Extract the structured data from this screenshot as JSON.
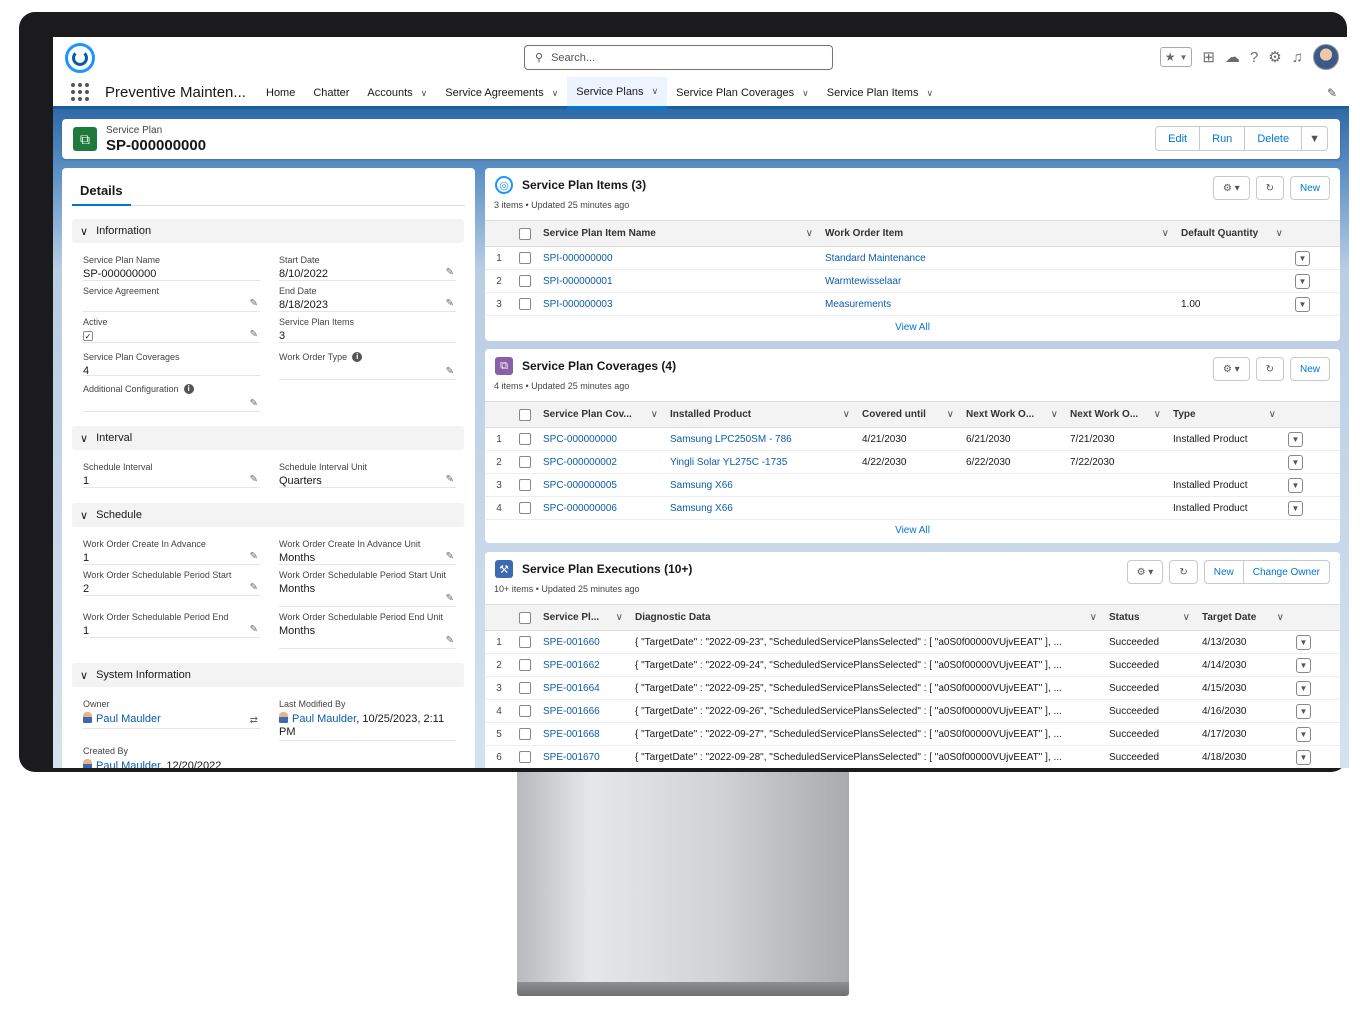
{
  "app": {
    "name": "Preventive Mainten...",
    "search_placeholder": "Search...",
    "nav_tabs": [
      {
        "label": "Home",
        "has_menu": false
      },
      {
        "label": "Chatter",
        "has_menu": false
      },
      {
        "label": "Accounts",
        "has_menu": true
      },
      {
        "label": "Service Agreements",
        "has_menu": true
      },
      {
        "label": "Service Plans",
        "has_menu": true,
        "active": true
      },
      {
        "label": "Service Plan Coverages",
        "has_menu": true
      },
      {
        "label": "Service Plan Items",
        "has_menu": true
      }
    ]
  },
  "record": {
    "type": "Service Plan",
    "name": "SP-000000000",
    "actions": {
      "edit": "Edit",
      "run": "Run",
      "delete": "Delete"
    }
  },
  "details": {
    "tab": "Details",
    "sections": {
      "information": "Information",
      "interval": "Interval",
      "schedule": "Schedule",
      "system": "System Information"
    },
    "fields": {
      "plan_name": {
        "label": "Service Plan Name",
        "value": "SP-000000000"
      },
      "start_date": {
        "label": "Start Date",
        "value": "8/10/2022"
      },
      "agreement": {
        "label": "Service Agreement",
        "value": ""
      },
      "end_date": {
        "label": "End Date",
        "value": "8/18/2023"
      },
      "active": {
        "label": "Active",
        "value": "✓"
      },
      "plan_items": {
        "label": "Service Plan Items",
        "value": "3"
      },
      "coverages": {
        "label": "Service Plan Coverages",
        "value": "4"
      },
      "wo_type": {
        "label": "Work Order Type",
        "value": ""
      },
      "addl_config": {
        "label": "Additional Configuration",
        "value": ""
      },
      "sched_interval": {
        "label": "Schedule Interval",
        "value": "1"
      },
      "sched_interval_unit": {
        "label": "Schedule Interval Unit",
        "value": "Quarters"
      },
      "wo_create_adv": {
        "label": "Work Order Create In Advance",
        "value": "1"
      },
      "wo_create_adv_unit": {
        "label": "Work Order Create In Advance Unit",
        "value": "Months"
      },
      "wo_sched_start": {
        "label": "Work Order Schedulable Period Start",
        "value": "2"
      },
      "wo_sched_start_unit": {
        "label": "Work Order Schedulable Period Start Unit",
        "value": "Months"
      },
      "wo_sched_end": {
        "label": "Work Order Schedulable Period End",
        "value": "1"
      },
      "wo_sched_end_unit": {
        "label": "Work Order Schedulable Period End Unit",
        "value": "Months"
      },
      "owner": {
        "label": "Owner",
        "value": "Paul Maulder"
      },
      "last_modified": {
        "label": "Last Modified By",
        "value": "Paul Maulder",
        "date": ", 10/25/2023, 2:11 PM"
      },
      "created_by": {
        "label": "Created By",
        "value": "Paul Maulder",
        "date": ", 12/20/2022"
      }
    }
  },
  "items_card": {
    "title": "Service Plan Items (3)",
    "subtitle": "3 items • Updated 25 minutes ago",
    "new": "New",
    "view_all": "View All",
    "columns": [
      "Service Plan Item Name",
      "Work Order Item",
      "Default Quantity"
    ],
    "rows": [
      {
        "n": "1",
        "name": "SPI-000000000",
        "item": "Standard Maintenance",
        "qty": ""
      },
      {
        "n": "2",
        "name": "SPI-000000001",
        "item": "Warmtewisselaar",
        "qty": ""
      },
      {
        "n": "3",
        "name": "SPI-000000003",
        "item": "Measurements",
        "qty": "1.00"
      }
    ]
  },
  "coverages_card": {
    "title": "Service Plan Coverages (4)",
    "subtitle": "4 items • Updated 25 minutes ago",
    "new": "New",
    "view_all": "View All",
    "columns": [
      "Service Plan Cov...",
      "Installed Product",
      "Covered until",
      "Next Work O...",
      "Next Work O...",
      "Type"
    ],
    "rows": [
      {
        "n": "1",
        "name": "SPC-000000000",
        "product": "Samsung LPC250SM - 786",
        "covered": "4/21/2030",
        "next1": "6/21/2030",
        "next2": "7/21/2030",
        "type": "Installed Product"
      },
      {
        "n": "2",
        "name": "SPC-000000002",
        "product": "Yingli Solar YL275C -1735",
        "covered": "4/22/2030",
        "next1": "6/22/2030",
        "next2": "7/22/2030",
        "type": ""
      },
      {
        "n": "3",
        "name": "SPC-000000005",
        "product": "Samsung X66",
        "covered": "",
        "next1": "",
        "next2": "",
        "type": "Installed Product"
      },
      {
        "n": "4",
        "name": "SPC-000000006",
        "product": "Samsung X66",
        "covered": "",
        "next1": "",
        "next2": "",
        "type": "Installed Product"
      }
    ]
  },
  "executions_card": {
    "title": "Service Plan Executions (10+)",
    "subtitle": "10+ items • Updated 25 minutes ago",
    "new": "New",
    "change_owner": "Change Owner",
    "columns": [
      "Service Pl...",
      "Diagnostic Data",
      "Status",
      "Target Date"
    ],
    "rows": [
      {
        "n": "1",
        "name": "SPE-001660",
        "diag": "{ \"TargetDate\" : \"2022-09-23\", \"ScheduledServicePlansSelected\" : [ \"a0S0f00000VUjvEEAT\" ], ...",
        "status": "Succeeded",
        "date": "4/13/2030"
      },
      {
        "n": "2",
        "name": "SPE-001662",
        "diag": "{ \"TargetDate\" : \"2022-09-24\", \"ScheduledServicePlansSelected\" : [ \"a0S0f00000VUjvEEAT\" ], ...",
        "status": "Succeeded",
        "date": "4/14/2030"
      },
      {
        "n": "3",
        "name": "SPE-001664",
        "diag": "{ \"TargetDate\" : \"2022-09-25\", \"ScheduledServicePlansSelected\" : [ \"a0S0f00000VUjvEEAT\" ], ...",
        "status": "Succeeded",
        "date": "4/15/2030"
      },
      {
        "n": "4",
        "name": "SPE-001666",
        "diag": "{ \"TargetDate\" : \"2022-09-26\", \"ScheduledServicePlansSelected\" : [ \"a0S0f00000VUjvEEAT\" ], ...",
        "status": "Succeeded",
        "date": "4/16/2030"
      },
      {
        "n": "5",
        "name": "SPE-001668",
        "diag": "{ \"TargetDate\" : \"2022-09-27\", \"ScheduledServicePlansSelected\" : [ \"a0S0f00000VUjvEEAT\" ], ...",
        "status": "Succeeded",
        "date": "4/17/2030"
      },
      {
        "n": "6",
        "name": "SPE-001670",
        "diag": "{ \"TargetDate\" : \"2022-09-28\", \"ScheduledServicePlansSelected\" : [ \"a0S0f00000VUjvEEAT\" ], ...",
        "status": "Succeeded",
        "date": "4/18/2030"
      }
    ]
  },
  "colors": {
    "brand": "#0176d3",
    "record_icon": "#1e7a3c",
    "items_icon": "#1b96ff",
    "coverages_icon": "#8b5fa8",
    "executions_icon": "#3c6ab0"
  },
  "icons": [
    "search-icon",
    "favorites-star-icon",
    "add-icon",
    "trailhead-icon",
    "help-icon",
    "setup-gear-icon",
    "notification-bell-icon",
    "user-avatar",
    "waffle-icon",
    "pencil-icon"
  ]
}
